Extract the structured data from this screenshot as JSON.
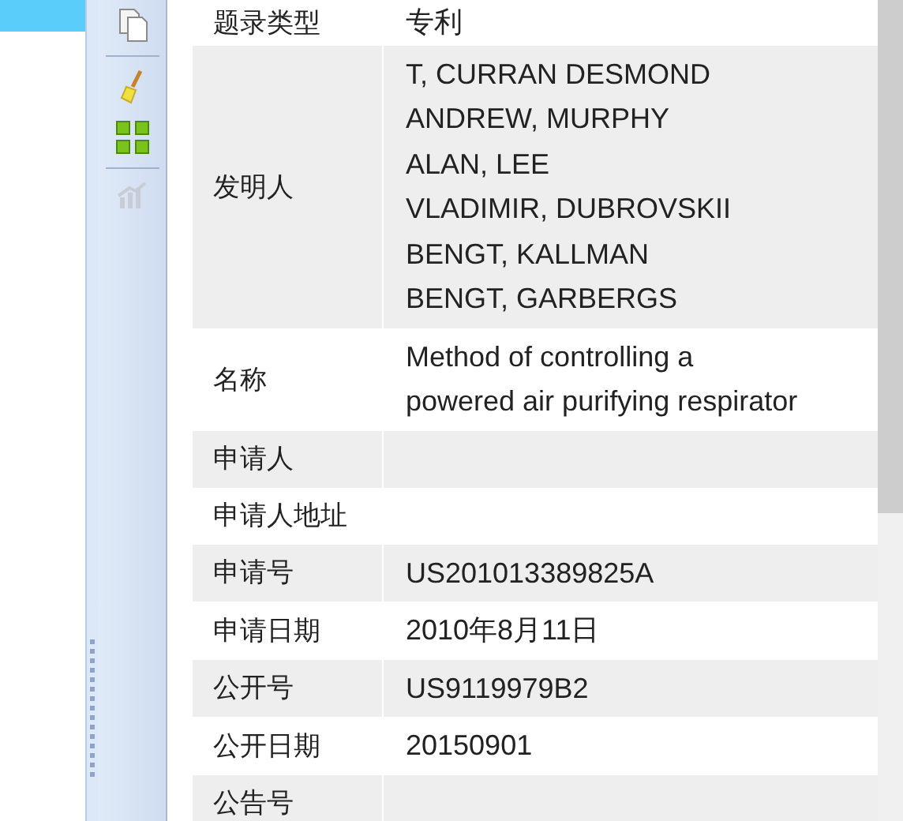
{
  "rows": [
    {
      "label": "题录类型",
      "lines": [
        "专利"
      ]
    },
    {
      "label": "发明人",
      "lines": [
        "T, CURRAN DESMOND",
        "ANDREW, MURPHY",
        "ALAN, LEE",
        "VLADIMIR, DUBROVSKII",
        "BENGT, KALLMAN",
        "BENGT, GARBERGS"
      ]
    },
    {
      "label": "名称",
      "lines": [
        "Method of controlling a",
        "powered air purifying respirator"
      ]
    },
    {
      "label": "申请人",
      "lines": []
    },
    {
      "label": "申请人地址",
      "lines": []
    },
    {
      "label": "申请号",
      "lines": [
        "US201013389825A"
      ]
    },
    {
      "label": "申请日期",
      "lines": [
        "2010年8月11日"
      ]
    },
    {
      "label": "公开号",
      "lines": [
        "US9119979B2"
      ]
    },
    {
      "label": "公开日期",
      "lines": [
        "20150901"
      ]
    },
    {
      "label": "公告号",
      "lines": []
    }
  ]
}
